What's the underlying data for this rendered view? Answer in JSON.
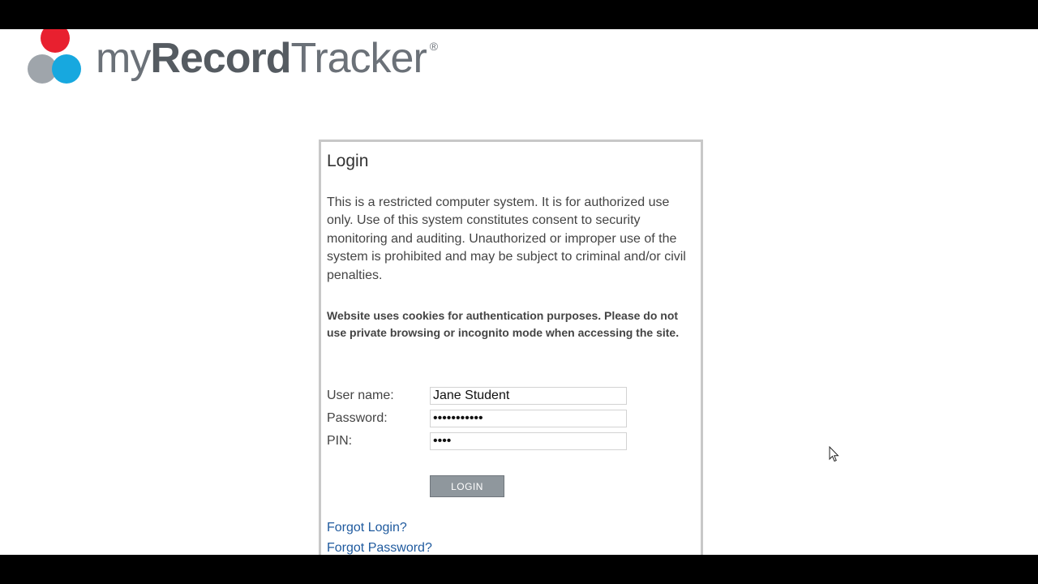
{
  "brand": {
    "name_part1": "my",
    "name_part2": "Record",
    "name_part3": "Tracker",
    "registered": "®"
  },
  "login": {
    "title": "Login",
    "notice": "This is a restricted computer system. It is for authorized use only. Use of this system constitutes consent to security monitoring and auditing. Unauthorized or improper use of the system is prohibited and may be subject to criminal and/or civil penalties.",
    "cookie_notice": "Website uses cookies for authentication purposes. Please do not use private browsing or incognito mode when accessing the site.",
    "fields": {
      "username_label": "User name:",
      "username_value": "Jane Student",
      "password_label": "Password:",
      "password_value": "•••••••••••",
      "pin_label": "PIN:",
      "pin_value": "••••"
    },
    "button_label": "LOGIN",
    "forgot_login": "Forgot Login?",
    "forgot_password": "Forgot Password?"
  },
  "colors": {
    "brand_red": "#e8202f",
    "brand_blue": "#17a8df",
    "brand_gray": "#9fa5ab",
    "link": "#1f5a9e",
    "button": "#8f979d"
  }
}
